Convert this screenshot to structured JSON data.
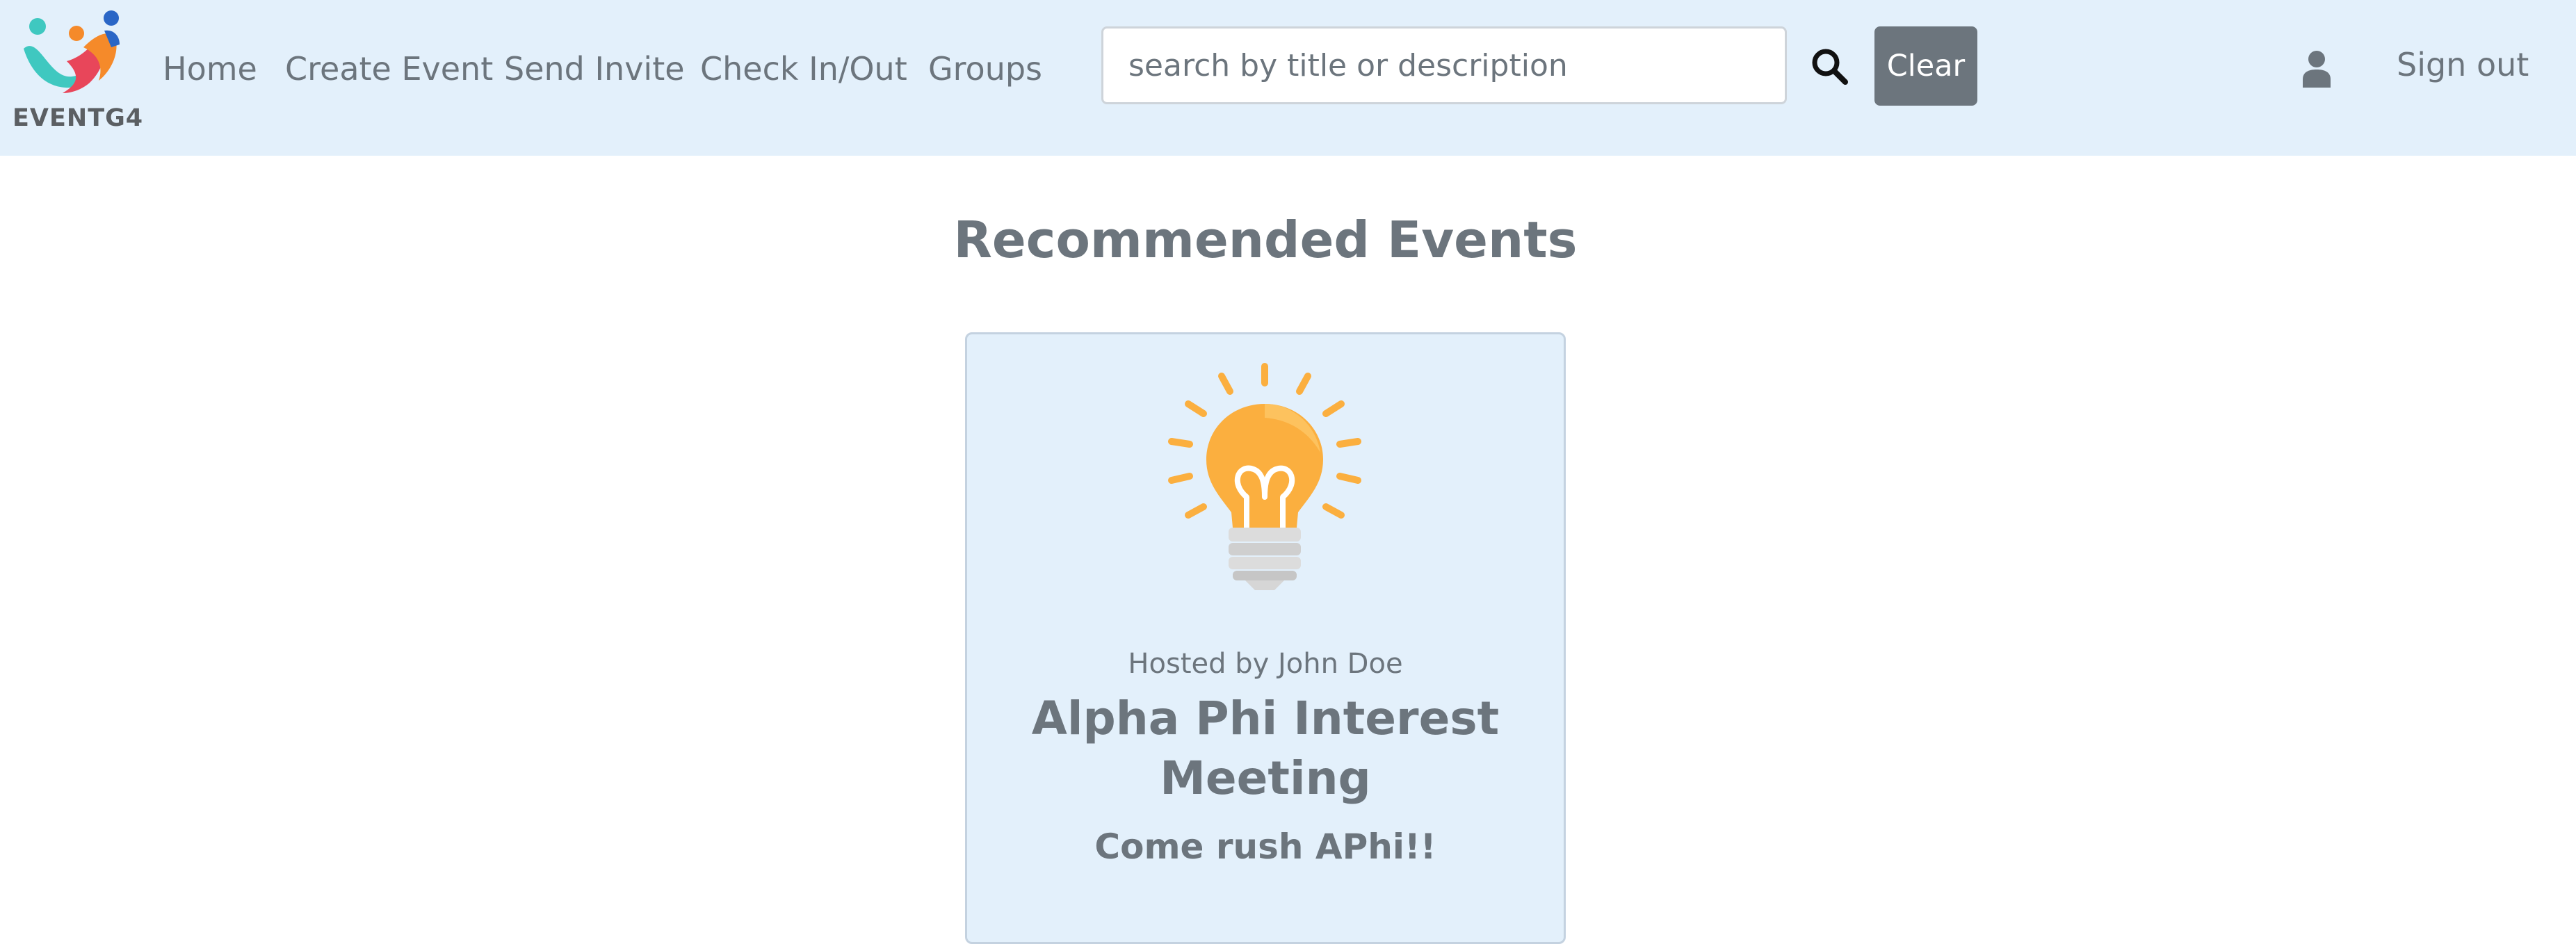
{
  "brand": {
    "name": "EVENTG4",
    "icon": "people-logo-icon"
  },
  "nav": {
    "items": [
      {
        "label": "Home"
      },
      {
        "label": "Create Event"
      },
      {
        "label": "Send Invite"
      },
      {
        "label": "Check In/Out"
      },
      {
        "label": "Groups"
      }
    ]
  },
  "search": {
    "placeholder": "search by title or description",
    "value": "",
    "icon": "search-icon",
    "clear_label": "Clear"
  },
  "user": {
    "icon": "user-icon",
    "signout_label": "Sign out"
  },
  "main": {
    "heading": "Recommended Events",
    "events": [
      {
        "image_icon": "lightbulb-icon",
        "host": "Hosted by John Doe",
        "title": "Alpha Phi Interest Meeting",
        "description": "Come rush APhi!!"
      }
    ]
  },
  "colors": {
    "navbar_bg": "#e3f0fb",
    "text_muted": "#6c757d",
    "button_secondary": "#6c757d",
    "card_bg": "#e3f0fb",
    "bulb": "#fbaf3f"
  }
}
